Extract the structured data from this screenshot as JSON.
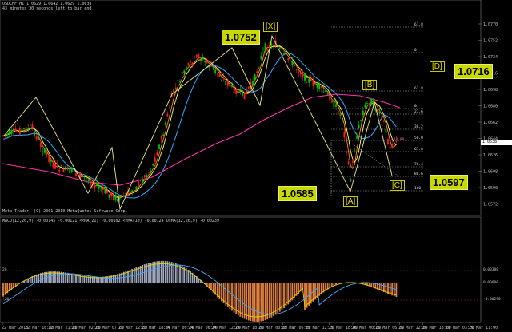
{
  "header": {
    "symbol_line": "USDCHF,H1  1.0629 1.0642 1.0629 1.0638",
    "timer_line": "43 minutes 30 seconds left to bar end"
  },
  "macd_header": "MACD(12,26,9) -0.00145 -0.00121  <<MA(21) -0.00102  <<MA(10) -0.00124  OsMA(12,26,9) -0.00239",
  "copyright": "Meta Trader, (C) 2001-2010 MetaQuotes Software Corp.",
  "current_price": "1.0638",
  "current_price_color": "#ffffff",
  "annotations": {
    "high_x": "1.0752",
    "target_d": "1.0716",
    "low_a": "1.0585",
    "target_c": "1.0597"
  },
  "wave_labels": {
    "x": "[X]",
    "a": "[A]",
    "b": "[B]",
    "c": "[C]",
    "d": "[D]"
  },
  "price_axis": [
    "1.0770",
    "1.0752",
    "1.0734",
    "1.0716",
    "1.0698",
    "1.0680",
    "1.0662",
    "1.0644",
    "1.0626",
    "1.0608",
    "1.0590",
    "1.0572"
  ],
  "price_axis_colors": {
    "text": "#c0c0c0"
  },
  "fib_levels": [
    "61.8",
    "0",
    "61.8",
    "0",
    "23.6",
    "38.2",
    "50.0",
    "61.8",
    "76.4",
    "88.6",
    "100"
  ],
  "pink_level": "+23.00",
  "macd_axis": [
    "0.00388",
    "0.00000",
    "-0.00290"
  ],
  "macd_left_labels": [
    "20",
    "-20"
  ],
  "time_axis": [
    "22 Mar 2010",
    "22 Mar 16:00",
    "22 Mar 21:00",
    "23 Mar 02:00",
    "23 Mar 07:00",
    "23 Mar 12:00",
    "23 Mar 18:00",
    "24 Mar 00:00",
    "24 Mar 06:00",
    "24 Mar 12:00",
    "24 Mar 18:00",
    "25 Mar 00:00",
    "25 Mar 06:00",
    "25 Mar 12:00",
    "25 Mar 18:00",
    "26 Mar 00:00",
    "26 Mar 06:00",
    "26 Mar 12:00",
    "26 Mar 18:00",
    "29 Mar 03:00",
    "29 Mar 11:00"
  ],
  "colors": {
    "bull_candle": "#00c800",
    "bear_candle": "#ff1e1e",
    "ma_yellow": "#ffff66",
    "ma_orange": "#ff8c00",
    "ma_blue": "#33aaff",
    "ma_magenta": "#ff33aa",
    "wave_line": "#f0e68c",
    "macd_hist_pos": "#a0a8c0",
    "macd_hist_neg": "#e08040"
  }
}
